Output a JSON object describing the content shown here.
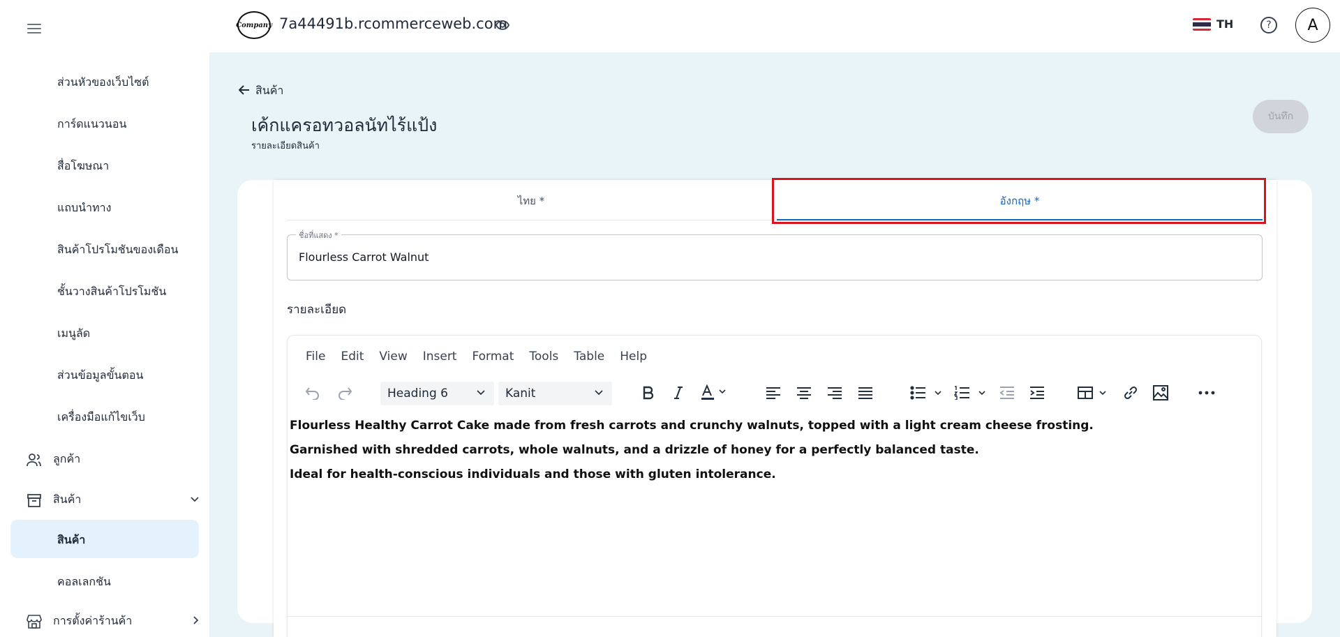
{
  "header": {
    "logo_text": "Company",
    "domain": "7a44491b.rcommerceweb.com",
    "language": "TH",
    "help_symbol": "?",
    "avatar_initial": "A"
  },
  "sidebar": {
    "sub_items": [
      "ส่วนหัวของเว็บไซต์",
      "การ์ดแนวนอน",
      "สื่อโฆษณา",
      "แถบนำทาง",
      "สินค้าโปรโมชันของเดือน",
      "ชั้นวางสินค้าโปรโมชัน",
      "เมนูลัด",
      "ส่วนข้อมูลขั้นตอน",
      "เครื่องมือแก้ไขเว็บ"
    ],
    "customers": "ลูกค้า",
    "products": "สินค้า",
    "products_sub": "สินค้า",
    "collections": "คอลเลกชัน",
    "store_settings": "การตั้งค่าร้านค้า"
  },
  "page": {
    "back_label": "สินค้า",
    "title": "เค้กแครอทวอลนัทไร้แป้ง",
    "subtitle": "รายละเอียดสินค้า",
    "save_label": "บันทึก"
  },
  "tabs": {
    "thai": "ไทย *",
    "english": "อังกฤษ *"
  },
  "name_field": {
    "label": "ชื่อที่แสดง *",
    "value": "Flourless Carrot Walnut"
  },
  "description": {
    "label": "รายละเอียด",
    "menu": [
      "File",
      "Edit",
      "View",
      "Insert",
      "Format",
      "Tools",
      "Table",
      "Help"
    ],
    "block_format": "Heading 6",
    "font_family": "Kanit",
    "lines": [
      "Flourless Healthy Carrot Cake made from fresh carrots and crunchy walnuts, topped with a light cream cheese frosting.",
      "Garnished with shredded carrots, whole walnuts, and a drizzle of honey for a perfectly balanced taste.",
      "Ideal for health-conscious individuals and those with gluten intolerance."
    ]
  },
  "colors": {
    "accent": "#1565c0",
    "highlight": "#d9141c",
    "background": "#e9f4f9",
    "active_item": "#e3f2fc"
  }
}
